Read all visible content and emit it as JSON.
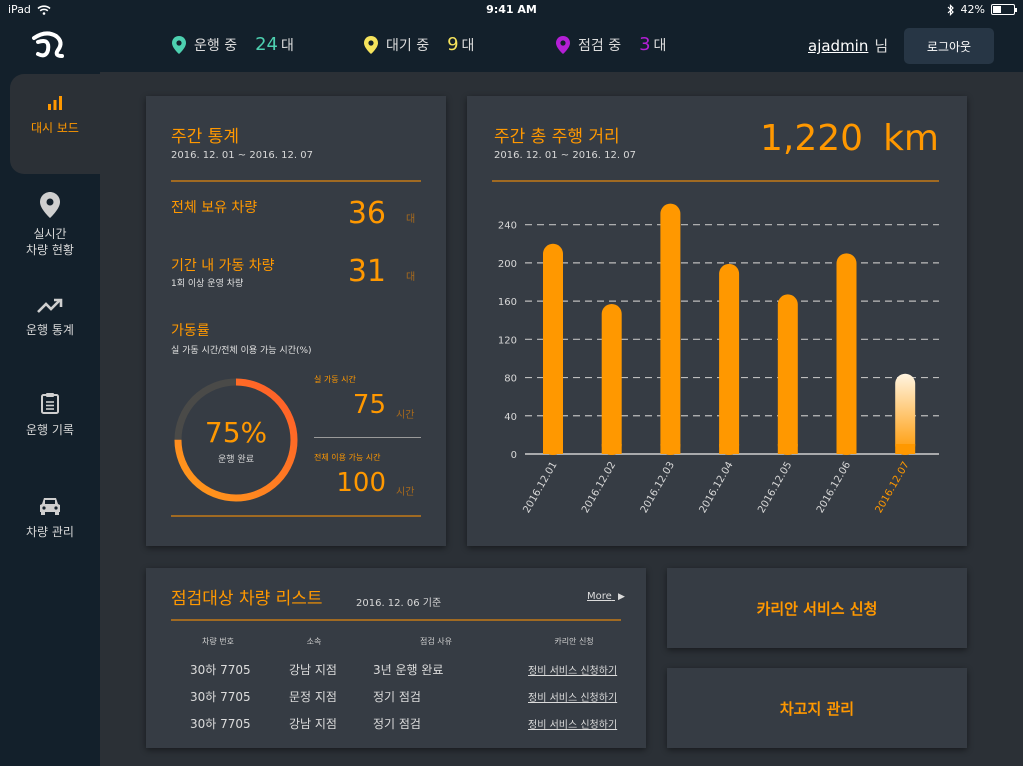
{
  "status_bar": {
    "device": "iPad",
    "time": "9:41 AM",
    "battery": "42%",
    "battery_level": 0.42
  },
  "header": {
    "stats": [
      {
        "label": "운행 중",
        "count": "24",
        "unit": "대",
        "color": "#4dd0b0"
      },
      {
        "label": "대기 중",
        "count": "9",
        "unit": "대",
        "color": "#f5e35c"
      },
      {
        "label": "점검 중",
        "count": "3",
        "unit": "대",
        "color": "#b41fd6"
      }
    ],
    "user": {
      "name": "ajadmin",
      "suffix": "님"
    },
    "logout_label": "로그아웃"
  },
  "sidebar": {
    "items": [
      {
        "label": "대시 보드",
        "icon": "bar-chart-icon",
        "active": true
      },
      {
        "label_line1": "실시간",
        "label_line2": "차량 현황",
        "icon": "location-pin-icon"
      },
      {
        "label": "운행 통계",
        "icon": "trending-up-icon"
      },
      {
        "label": "운행 기록",
        "icon": "clipboard-icon"
      },
      {
        "label": "차량 관리",
        "icon": "car-icon"
      }
    ]
  },
  "weekly_stats": {
    "title": "주간 통계",
    "period": "2016. 12. 01 ~ 2016. 12. 07",
    "total_vehicles": {
      "label": "전체 보유 차량",
      "value": "36",
      "unit": "대"
    },
    "active_vehicles": {
      "label": "기간 내 가동 차량",
      "sub": "1회 이상 운영 차량",
      "value": "31",
      "unit": "대"
    },
    "utilization": {
      "label": "가동률",
      "sub": "실 가동 시간/전체 이용 가능 시간(%)",
      "percent": "75%",
      "percent_value": 75,
      "caption": "운행 완료",
      "actual_label": "실 가동 시간",
      "actual_value": "75",
      "actual_unit": "시간",
      "total_label": "전체 이용 가능 시간",
      "total_value": "100",
      "total_unit": "시간"
    }
  },
  "distance": {
    "title": "주간 총 주행 거리",
    "period": "2016. 12. 01 ~ 2016. 12. 07",
    "total": "1,220",
    "unit": "km"
  },
  "chart_data": {
    "type": "bar",
    "categories": [
      "2016.12.01",
      "2016.12.02",
      "2016.12.03",
      "2016.12.04",
      "2016.12.05",
      "2016.12.06",
      "2016.12.07"
    ],
    "values": [
      220,
      157,
      262,
      199,
      167,
      210,
      84
    ],
    "yticks": [
      0,
      40,
      80,
      120,
      160,
      200,
      240
    ],
    "ylim": [
      0,
      270
    ],
    "grid": true,
    "colors": {
      "bar": "#ff9800",
      "highlight_top": "#fff4e0",
      "highlight_bottom": "#ff9800",
      "highlight_label": "#ff9800"
    },
    "highlight_index": 6
  },
  "inspection": {
    "title": "점검대상 차량 리스트",
    "date": "2016. 12. 06 기준",
    "more": "More",
    "headers": [
      "차량 번호",
      "소속",
      "점검 사유",
      "카리안 신청"
    ],
    "rows": [
      [
        "30하 7705",
        "강남 지점",
        "3년 운행 완료",
        "정비 서비스 신청하기"
      ],
      [
        "30하 7705",
        "문정 지점",
        "정기 점검",
        "정비 서비스 신청하기"
      ],
      [
        "30하 7705",
        "강남 지점",
        "정기 점검",
        "정비 서비스 신청하기"
      ]
    ]
  },
  "actions": {
    "service": "카리안 서비스 신청",
    "garage": "차고지 관리"
  }
}
